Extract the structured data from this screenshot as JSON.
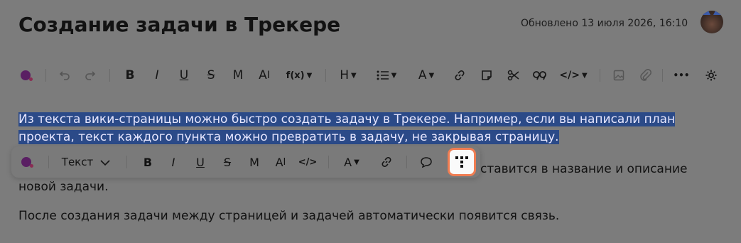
{
  "header": {
    "title": "Создание задачи в Трекере",
    "updated": "Обновлено 13 июля 2026, 16:10"
  },
  "toolbar": {
    "bold": "B",
    "italic": "I",
    "underline": "U",
    "strike": "S",
    "mono": "M",
    "text_style": "A",
    "formula": "f(x)",
    "heading": "H",
    "color": "A",
    "more": "•••",
    "code": "</>"
  },
  "content": {
    "selected_text": "Из текста вики-страницы можно быстро создать задачу в Трекере. Например, если вы написали план проекта, текст каждого пункта можно превратить в задачу, не закрывая страницу.",
    "para2_line1_tail": "ставится в название и описание",
    "para2_line2": "новой задачи.",
    "para3": "После создания задачи между страницей и задачей автоматически появится связь."
  },
  "popup": {
    "text_style": "Текст",
    "bold": "B",
    "italic": "I",
    "underline": "U",
    "strike": "S",
    "mono": "M",
    "text_size": "A",
    "code": "</>",
    "color": "A"
  },
  "colors": {
    "accent_dot": "#5a1f63",
    "highlight": "#2b4a88",
    "tracker_border": "#f07d52"
  }
}
